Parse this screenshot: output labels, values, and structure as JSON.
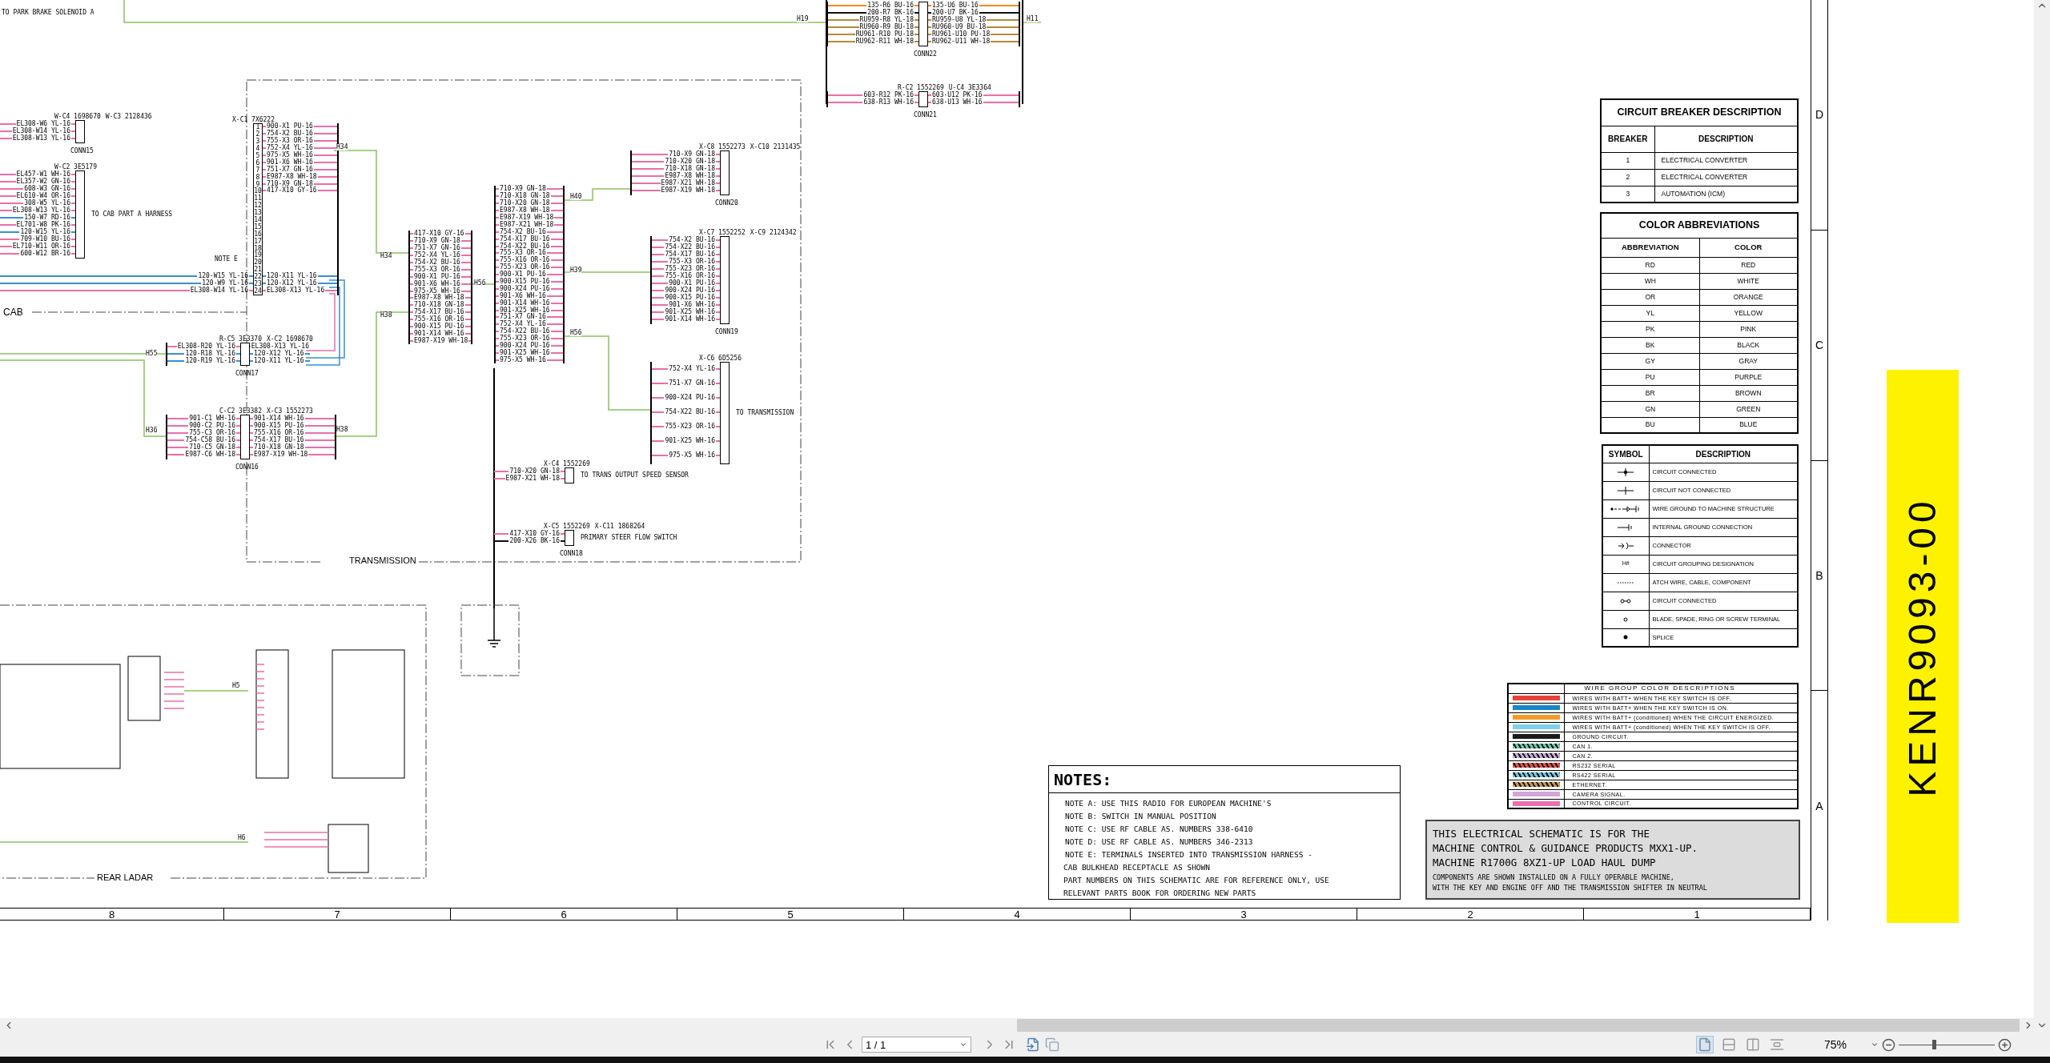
{
  "schematic": {
    "labels": [
      "TO PARK BRAKE SOLENOID A",
      "H19",
      "H11",
      "H34",
      "H34",
      "H38",
      "H38",
      "H56",
      "H40",
      "H39",
      "H56",
      "H55",
      "H36",
      "NOTE E",
      "H5",
      "H6"
    ],
    "areas": [
      {
        "title": "CAB"
      },
      {
        "title": "TRANSMISSION"
      },
      {
        "title": "REAR LADAR"
      }
    ],
    "connectors": [
      {
        "kind": "plug",
        "headers": [
          "W-C4 1698670",
          "W-C3 2128436"
        ],
        "name": "CONN15",
        "color": "#e86fa9",
        "pins": [
          {
            "left": "EL308-W6 YL-16"
          },
          {
            "left": "EL308-W14 YL-16"
          },
          {
            "left": "EL308-W13 YL-16"
          }
        ]
      },
      {
        "kind": "plug",
        "headers": [
          "W-C2 3E5179"
        ],
        "note": "TO CAB PART A HARNESS",
        "color": "#e86fa9",
        "pins": [
          {
            "left": "EL457-W1 WH-16"
          },
          {
            "left": "EL357-W2 GN-16"
          },
          {
            "left": "608-W3 GN-16"
          },
          {
            "left": "EL610-W4 OR-16"
          },
          {
            "left": "308-W5 YL-16"
          },
          {
            "left": "EL308-W13 YL-16"
          },
          {
            "left": "150-W7 RD-16",
            "color": "#3a8fd0"
          },
          {
            "left": "EL701-W8 PK-16"
          },
          {
            "left": "120-W15 YL-16",
            "color": "#3a8fd0"
          },
          {
            "left": "709-W10 BU-16"
          },
          {
            "left": "EL710-W11 OR-16"
          },
          {
            "left": "600-W12 BR-16"
          }
        ]
      },
      {
        "kind": "plug",
        "headers": [
          "X-C1 7X6222"
        ],
        "color": "#e86fa9",
        "pins": [
          {
            "n": "1",
            "right": "900-X1 PU-16"
          },
          {
            "n": "2",
            "right": "754-X2 BU-16"
          },
          {
            "n": "3",
            "right": "755-X3 OR-16"
          },
          {
            "n": "4",
            "right": "752-X4 YL-16"
          },
          {
            "n": "5",
            "right": "975-X5 WH-16"
          },
          {
            "n": "6",
            "right": "901-X6 WH-16"
          },
          {
            "n": "7",
            "right": "751-X7 GN-16"
          },
          {
            "n": "8",
            "right": "E987-X8 WH-18"
          },
          {
            "n": "9",
            "right": "710-X9 GN-18"
          },
          {
            "n": "10",
            "right": "417-X10 GY-16"
          },
          {
            "n": "11"
          },
          {
            "n": "12"
          },
          {
            "n": "13"
          },
          {
            "n": "14"
          },
          {
            "n": "15"
          },
          {
            "n": "16"
          },
          {
            "n": "17"
          },
          {
            "n": "18"
          },
          {
            "n": "19"
          },
          {
            "n": "20"
          },
          {
            "n": "21"
          },
          {
            "n": "22",
            "left": "120-W15 YL-16",
            "right": "120-X11 YL-16",
            "color": "#3a8fd0"
          },
          {
            "n": "23",
            "left": "120-W9 YL-16",
            "right": "120-X12 YL-16",
            "color": "#3a8fd0"
          },
          {
            "n": "24",
            "left": "EL308-W14 YL-16",
            "right": "EL308-X13 YL-16"
          }
        ]
      },
      {
        "kind": "plug",
        "headers": [
          "R-C5 3E3370",
          "X-C2 1698670"
        ],
        "name": "CONN17",
        "color": "#3a8fd0",
        "pins": [
          {
            "left": "EL308-R20 YL-16",
            "right": "EL308-X13 YL-16",
            "color": "#e86fa9"
          },
          {
            "left": "120-R18 YL-16",
            "right": "120-X12 YL-16"
          },
          {
            "left": "120-R19 YL-16",
            "right": "120-X11 YL-16"
          }
        ]
      },
      {
        "kind": "plug",
        "headers": [
          "C-C2 3E3382",
          "X-C3 1552273"
        ],
        "name": "CONN16",
        "color": "#e86fa9",
        "pins": [
          {
            "left": "901-C1 WH-16",
            "right": "901-X14 WH-16"
          },
          {
            "left": "900-C2 PU-16",
            "right": "900-X15 PU-16"
          },
          {
            "left": "755-C3 OR-16",
            "right": "755-X16 OR-16"
          },
          {
            "left": "754-C58 BU-16",
            "right": "754-X17 BU-16"
          },
          {
            "left": "710-C5 GN-18",
            "right": "710-X18 GN-18"
          },
          {
            "left": "E987-C6 WH-18",
            "right": "E987-X19 WH-18"
          }
        ]
      },
      {
        "kind": "bus",
        "color": "#e86fa9",
        "pins": [
          {
            "left": "417-X10 GY-16"
          },
          {
            "left": "710-X9 GN-18"
          },
          {
            "left": "751-X7 GN-16"
          },
          {
            "left": "752-X4 YL-16"
          },
          {
            "left": "754-X2 BU-16"
          },
          {
            "left": "755-X3 OR-16"
          },
          {
            "left": "900-X1 PU-16"
          },
          {
            "left": "901-X6 WH-16"
          },
          {
            "left": "975-X5 WH-16"
          },
          {
            "left": "E987-X8 WH-18"
          },
          {
            "left": "710-X18 GN-18"
          },
          {
            "left": "754-X17 BU-16"
          },
          {
            "left": "755-X16 OR-16"
          },
          {
            "left": "900-X15 PU-16"
          },
          {
            "left": "901-X14 WH-16"
          },
          {
            "left": "E987-X19 WH-18"
          }
        ]
      },
      {
        "kind": "bus",
        "color": "#e86fa9",
        "pins": [
          {
            "left": "710-X9 GN-18"
          },
          {
            "left": "710-X18 GN-18"
          },
          {
            "left": "710-X20 GN-18"
          },
          {
            "left": "E987-X8 WH-18"
          },
          {
            "left": "E987-X19 WH-18"
          },
          {
            "left": "E987-X21 WH-18"
          },
          {
            "left": "754-X2 BU-16"
          },
          {
            "left": "754-X17 BU-16"
          },
          {
            "left": "754-X22 BU-16"
          },
          {
            "left": "755-X3 OR-16"
          },
          {
            "left": "755-X16 OR-16"
          },
          {
            "left": "755-X23 OR-16"
          },
          {
            "left": "900-X1 PU-16"
          },
          {
            "left": "900-X15 PU-16"
          },
          {
            "left": "900-X24 PU-16"
          },
          {
            "left": "901-X6 WH-16"
          },
          {
            "left": "901-X14 WH-16"
          },
          {
            "left": "901-X25 WH-16"
          },
          {
            "left": "751-X7 GN-16"
          },
          {
            "left": "752-X4 YL-16"
          },
          {
            "left": "754-X22 BU-16"
          },
          {
            "left": "755-X23 OR-16"
          },
          {
            "left": "900-X24 PU-16"
          },
          {
            "left": "901-X25 WH-16"
          },
          {
            "left": "975-X5 WH-16"
          }
        ]
      },
      {
        "kind": "plug",
        "headers": [
          "X-C8 1552273",
          "X-C10 2131435"
        ],
        "name": "CONN20",
        "color": "#e86fa9",
        "pins": [
          {
            "left": "710-X9 GN-18"
          },
          {
            "left": "710-X20 GN-18"
          },
          {
            "left": "710-X18 GN-18"
          },
          {
            "left": "E987-X8 WH-18"
          },
          {
            "left": "E987-X21 WH-18"
          },
          {
            "left": "E987-X19 WH-18"
          }
        ]
      },
      {
        "kind": "plug",
        "headers": [
          "X-C7 1552252",
          "X-C9 2124342"
        ],
        "name": "CONN19",
        "color": "#e86fa9",
        "pins": [
          {
            "left": "754-X2 BU-16"
          },
          {
            "left": "754-X22 BU-16"
          },
          {
            "left": "754-X17 BU-16"
          },
          {
            "left": "755-X3 OR-16"
          },
          {
            "left": "755-X23 OR-16"
          },
          {
            "left": "755-X16 OR-16"
          },
          {
            "left": "900-X1 PU-16"
          },
          {
            "left": "900-X24 PU-16"
          },
          {
            "left": "900-X15 PU-16"
          },
          {
            "left": "901-X6 WH-16"
          },
          {
            "left": "901-X25 WH-16"
          },
          {
            "left": "901-X14 WH-16"
          }
        ]
      },
      {
        "kind": "plug",
        "headers": [
          "X-C6 6D5256"
        ],
        "note": "TO TRANSMISSION",
        "color": "#e86fa9",
        "pins": [
          {
            "left": "752-X4 YL-16"
          },
          {
            "left": "751-X7 GN-16"
          },
          {
            "left": "900-X24 PU-16"
          },
          {
            "left": "754-X22 BU-16"
          },
          {
            "left": "755-X23 OR-16"
          },
          {
            "left": "901-X25 WH-16"
          },
          {
            "left": "975-X5 WH-16"
          }
        ]
      },
      {
        "kind": "plug",
        "headers": [
          "X-C4 1552269"
        ],
        "note": "TO TRANS OUTPUT SPEED SENSOR",
        "color": "#e86fa9",
        "pins": [
          {
            "left": "710-X20 GN-18"
          },
          {
            "left": "E987-X21 WH-18"
          }
        ]
      },
      {
        "kind": "plug",
        "headers": [
          "X-C5 1552269",
          "X-C11 1868264"
        ],
        "name": "CONN18",
        "note": "PRIMARY STEER FLOW SWITCH",
        "color": "#e86fa9",
        "pins": [
          {
            "left": "417-X10 GY-16"
          },
          {
            "left": "200-X26 BK-16",
            "color": "#111111"
          }
        ]
      },
      {
        "kind": "plug",
        "name": "CONN22",
        "color": "#b58a3c",
        "pins": [
          {
            "left": "135-R6 BU-16",
            "right": "135-U6 BU-16",
            "color": "#f08a1c"
          },
          {
            "left": "200-R7 BK-16",
            "right": "200-U7 BK-16",
            "color": "#111111"
          },
          {
            "left": "RU959-R8 YL-18",
            "right": "RU959-U8 YL-18"
          },
          {
            "left": "RU960-R9 BU-18",
            "right": "RU960-U9 BU-18"
          },
          {
            "left": "RU961-R10 PU-18",
            "right": "RU961-U10 PU-18"
          },
          {
            "left": "RU962-R11 WH-18",
            "right": "RU962-U11 WH-18"
          }
        ]
      },
      {
        "kind": "plug",
        "headers": [
          "R-C2 1552269",
          "U-C4 3E3364"
        ],
        "name": "CONN21",
        "color": "#e86fa9",
        "pins": [
          {
            "left": "603-R12 PK-16",
            "right": "603-U12 PK-16"
          },
          {
            "left": "638-R13 WH-16",
            "right": "638-U13 WH-16"
          }
        ]
      }
    ]
  },
  "grid": {
    "columns": [
      "8",
      "7",
      "6",
      "5",
      "4",
      "3",
      "2",
      "1"
    ],
    "rows": [
      "D",
      "C",
      "B",
      "A"
    ]
  },
  "circuit_breakers": {
    "title": "CIRCUIT BREAKER DESCRIPTION",
    "columns": [
      "BREAKER",
      "DESCRIPTION"
    ],
    "rows": [
      [
        "1",
        "ELECTRICAL CONVERTER"
      ],
      [
        "2",
        "ELECTRICAL CONVERTER"
      ],
      [
        "3",
        "AUTOMATION (ICM)"
      ]
    ]
  },
  "color_abbreviations": {
    "title": "COLOR ABBREVIATIONS",
    "columns": [
      "ABBREVIATION",
      "COLOR"
    ],
    "rows": [
      [
        "RD",
        "RED"
      ],
      [
        "WH",
        "WHITE"
      ],
      [
        "OR",
        "ORANGE"
      ],
      [
        "YL",
        "YELLOW"
      ],
      [
        "PK",
        "PINK"
      ],
      [
        "BK",
        "BLACK"
      ],
      [
        "GY",
        "GRAY"
      ],
      [
        "PU",
        "PURPLE"
      ],
      [
        "BR",
        "BROWN"
      ],
      [
        "GN",
        "GREEN"
      ],
      [
        "BU",
        "BLUE"
      ]
    ]
  },
  "symbols": {
    "columns": [
      "SYMBOL",
      "DESCRIPTION"
    ],
    "rows": [
      {
        "kind": "dot-cross",
        "description": "CIRCUIT CONNECTED"
      },
      {
        "kind": "cross",
        "description": "CIRCUIT NOT CONNECTED"
      },
      {
        "kind": "wire-ground",
        "description": "WIRE GROUND TO MACHINE STRUCTURE"
      },
      {
        "kind": "internal-ground",
        "description": "INTERNAL GROUND CONNECTION"
      },
      {
        "kind": "connector",
        "description": "CONNECTOR"
      },
      {
        "kind": "text",
        "symbol": "H#",
        "description": "CIRCUIT GROUPING DESIGNATION"
      },
      {
        "kind": "dotted",
        "description": "ATCH WIRE, CABLE, COMPONENT"
      },
      {
        "kind": "link",
        "description": "CIRCUIT CONNECTED"
      },
      {
        "kind": "ring",
        "description": "BLADE, SPADE, RING OR SCREW TERMINAL"
      },
      {
        "kind": "splice",
        "description": "SPLICE"
      }
    ]
  },
  "wire_groups": {
    "title": "WIRE GROUP COLOR DESCRIPTIONS",
    "rows": [
      {
        "kind": "solid",
        "color": "#e8403a",
        "description": "WIRES WITH BATT+ WHEN THE KEY SWITCH IS OFF."
      },
      {
        "kind": "solid",
        "color": "#1a86c8",
        "description": "WIRES WITH BATT+ WHEN THE KEY SWITCH IS ON."
      },
      {
        "kind": "solid",
        "color": "#f39a2a",
        "description": "WIRES WITH BATT+ (conditioned) WHEN THE CIRCUIT ENERGIZED."
      },
      {
        "kind": "solid",
        "color": "#7fd0e8",
        "description": "WIRES WITH BATT+ (conditioned) WHEN THE KEY SWITCH IS OFF."
      },
      {
        "kind": "solid",
        "color": "#1a1a1a",
        "description": "GROUND CIRCUIT."
      },
      {
        "kind": "striped",
        "color": "#6cc8a8",
        "description": "CAN 1."
      },
      {
        "kind": "striped",
        "color": "#c4a6dc",
        "description": "CAN 2."
      },
      {
        "kind": "striped",
        "color": "#e8504a",
        "description": "RS232 SERIAL"
      },
      {
        "kind": "striped",
        "color": "#6cc8dc",
        "description": "RS422 SERIAL"
      },
      {
        "kind": "striped",
        "color": "#c69a50",
        "description": "ETHERNET."
      },
      {
        "kind": "solid",
        "color": "#d2a6d8",
        "description": "CAMERA SIGNAL."
      },
      {
        "kind": "solid",
        "color": "#ec70b0",
        "description": "CONTROL CIRCUIT."
      }
    ]
  },
  "notes": {
    "title": "NOTES:",
    "lines": [
      "NOTE A: USE THIS RADIO FOR EUROPEAN MACHINE'S",
      "NOTE B: SWITCH IN MANUAL POSITION",
      "NOTE C: USE RF CABLE AS. NUMBERS 338-6410",
      "NOTE D: USE RF CABLE AS. NUMBERS 346-2313",
      "NOTE E: TERMINALS INSERTED INTO TRANSMISSION HARNESS -",
      "CAB BULKHEAD RECEPTACLE AS SHOWN",
      "PART NUMBERS ON THIS SCHEMATIC ARE FOR REFERENCE ONLY, USE",
      "RELEVANT PARTS BOOK FOR ORDERING NEW PARTS"
    ]
  },
  "applicability": {
    "lines": [
      "THIS ELECTRICAL SCHEMATIC IS FOR THE",
      "MACHINE CONTROL & GUIDANCE PRODUCTS MXX1-UP.",
      "MACHINE R1700G 8XZ1-UP LOAD HAUL DUMP"
    ],
    "details": [
      "COMPONENTS ARE SHOWN INSTALLED ON A FULLY OPERABLE MACHINE,",
      "WITH THE KEY AND ENGINE OFF AND THE TRANSMISSION SHIFTER IN NEUTRAL"
    ]
  },
  "document_number": "KENR9093-00",
  "viewer": {
    "page_field": "1 / 1",
    "zoom": "75%",
    "zoom_slider": {
      "level": 0.37
    },
    "view_modes": [
      {
        "kind": "single",
        "selected": true
      },
      {
        "kind": "continuous",
        "selected": false
      },
      {
        "kind": "facing",
        "selected": false
      },
      {
        "kind": "continuous-facing",
        "selected": false
      }
    ]
  }
}
